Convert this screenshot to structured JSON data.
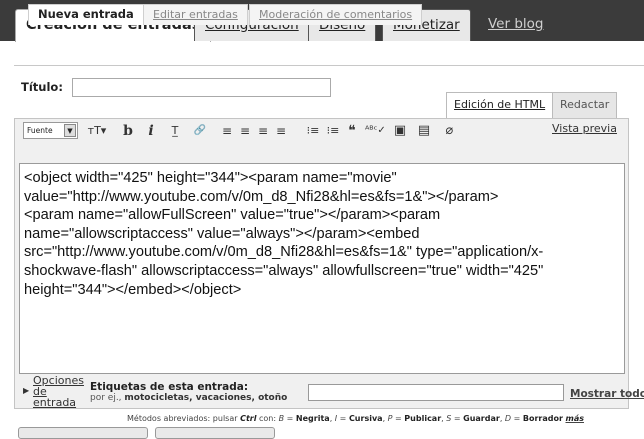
{
  "main_tabs": [
    {
      "label": "Creación de entradas",
      "active": true
    },
    {
      "label": "Configuración"
    },
    {
      "label": "Diseño"
    },
    {
      "label": "Monetizar"
    },
    {
      "label": "Ver blog"
    }
  ],
  "sub_tabs": [
    {
      "label": "Nueva entrada",
      "active": true
    },
    {
      "label": "Editar entradas"
    },
    {
      "label": "Moderación de comentarios"
    }
  ],
  "title_field": {
    "label": "Título:",
    "value": ""
  },
  "editor_modes": {
    "html": "Edición de HTML",
    "compose": "Redactar"
  },
  "toolbar": {
    "font_select": "Fuente",
    "preview": "Vista previa",
    "buttons": [
      {
        "name": "font-size-icon",
        "glyph": "ᴛT▾"
      },
      {
        "name": "bold-icon",
        "glyph": "b"
      },
      {
        "name": "italic-icon",
        "glyph": "i"
      },
      {
        "name": "text-color-icon",
        "glyph": "T̲"
      },
      {
        "name": "link-icon",
        "glyph": "🔗"
      },
      {
        "name": "align-left-icon",
        "glyph": "≡"
      },
      {
        "name": "align-center-icon",
        "glyph": "≡"
      },
      {
        "name": "align-right-icon",
        "glyph": "≡"
      },
      {
        "name": "align-justify-icon",
        "glyph": "≡"
      },
      {
        "name": "numbered-list-icon",
        "glyph": "⁝≡"
      },
      {
        "name": "bullet-list-icon",
        "glyph": "⁝≡"
      },
      {
        "name": "blockquote-icon",
        "glyph": "❝"
      },
      {
        "name": "spellcheck-icon",
        "glyph": "ᴬᴮᶜ✓"
      },
      {
        "name": "insert-image-icon",
        "glyph": "▣"
      },
      {
        "name": "insert-video-icon",
        "glyph": "▤"
      },
      {
        "name": "remove-format-icon",
        "glyph": "⌀"
      }
    ]
  },
  "editor_lines": [
    "<object width=\"425\" height=\"344\"><param name=\"movie\"",
    "value=\"http://www.youtube.com/v/0m_d8_Nfi28&hl=es&fs=1&\"></param>",
    "<param name=\"allowFullScreen\" value=\"true\"></param><param",
    "name=\"allowscriptaccess\" value=\"always\"></param><embed",
    "src=\"http://www.youtube.com/v/0m_d8_Nfi28&hl=es&fs=1&\" type=\"application/x-",
    "shockwave-flash\" allowscriptaccess=\"always\" allowfullscreen=\"true\" width=\"425\"",
    "height=\"344\"></embed></object>"
  ],
  "options_link": "Opciones de entrada",
  "labels": {
    "title": "Etiquetas de esta entrada:",
    "hint_prefix": "por ej.,",
    "hint_examples": "motocicletas, vacaciones, otoño",
    "value": "",
    "show_all": "Mostrar todo"
  },
  "shortcuts": {
    "prefix": "Métodos abreviados: pulsar",
    "key": "Ctrl",
    "con": "con:",
    "b_key": "B",
    "b_label": "Negrita",
    "i_key": "I",
    "i_label": "Cursiva",
    "p_key": "P",
    "p_label": "Publicar",
    "s_key": "S",
    "s_label": "Guardar",
    "d_key": "D",
    "d_label": "Borrador",
    "more": "más"
  }
}
